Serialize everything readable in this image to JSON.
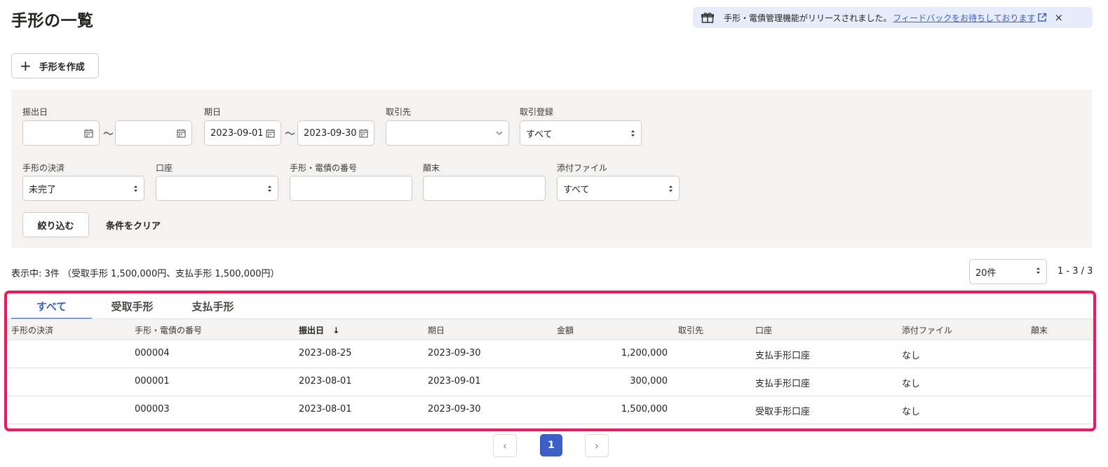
{
  "page": {
    "title": "手形の一覧"
  },
  "notice": {
    "message": "手形・電債管理機能がリリースされました。",
    "link": "フィードバックをお待ちしております",
    "close": "×"
  },
  "toolbar": {
    "create_label": "手形を作成",
    "plus": "+"
  },
  "filters": {
    "issue_date_label": "振出日",
    "issue_date_from": "",
    "issue_date_to": "",
    "due_date_label": "期日",
    "due_date_from": "2023-09-01",
    "due_date_to": "2023-09-30",
    "partner_label": "取引先",
    "partner_value": "",
    "registration_label": "取引登録",
    "registration_value": "すべて",
    "settlement_label": "手形の決済",
    "settlement_value": "未完了",
    "account_label": "口座",
    "account_value": "",
    "number_label": "手形・電債の番号",
    "number_value": "",
    "status_label": "顛末",
    "status_value": "",
    "attachment_label": "添付ファイル",
    "attachment_value": "すべて",
    "tilde": "〜",
    "apply_label": "絞り込む",
    "clear_label": "条件をクリア"
  },
  "summary": {
    "text": "表示中: 3件 （受取手形 1,500,000円、支払手形 1,500,000円）",
    "per_page": "20件",
    "range": "1 - 3 / 3"
  },
  "tabs": [
    {
      "label": "すべて"
    },
    {
      "label": "受取手形"
    },
    {
      "label": "支払手形"
    }
  ],
  "table": {
    "headers": {
      "settlement": "手形の決済",
      "number": "手形・電債の番号",
      "issue_date": "振出日",
      "sort_arrow": "↓",
      "due_date": "期日",
      "amount": "金額",
      "partner": "取引先",
      "account": "口座",
      "attachment": "添付ファイル",
      "status": "顛末"
    },
    "rows": [
      {
        "settlement": "",
        "number": "000004",
        "issue_date": "2023-08-25",
        "due_date": "2023-09-30",
        "amount": "1,200,000",
        "partner": "",
        "account": "支払手形口座",
        "attachment": "なし",
        "status": ""
      },
      {
        "settlement": "",
        "number": "000001",
        "issue_date": "2023-08-01",
        "due_date": "2023-09-01",
        "amount": "300,000",
        "partner": "",
        "account": "支払手形口座",
        "attachment": "なし",
        "status": ""
      },
      {
        "settlement": "",
        "number": "000003",
        "issue_date": "2023-08-01",
        "due_date": "2023-09-30",
        "amount": "1,500,000",
        "partner": "",
        "account": "受取手形口座",
        "attachment": "なし",
        "status": ""
      }
    ]
  },
  "pagination": {
    "prev": "‹",
    "current": "1",
    "next": "›"
  },
  "colors": {
    "accent": "#3b5fc4",
    "highlight_border": "#f0175a",
    "panel_bg": "#f4f3f2",
    "notice_bg": "#e7ecfb"
  }
}
